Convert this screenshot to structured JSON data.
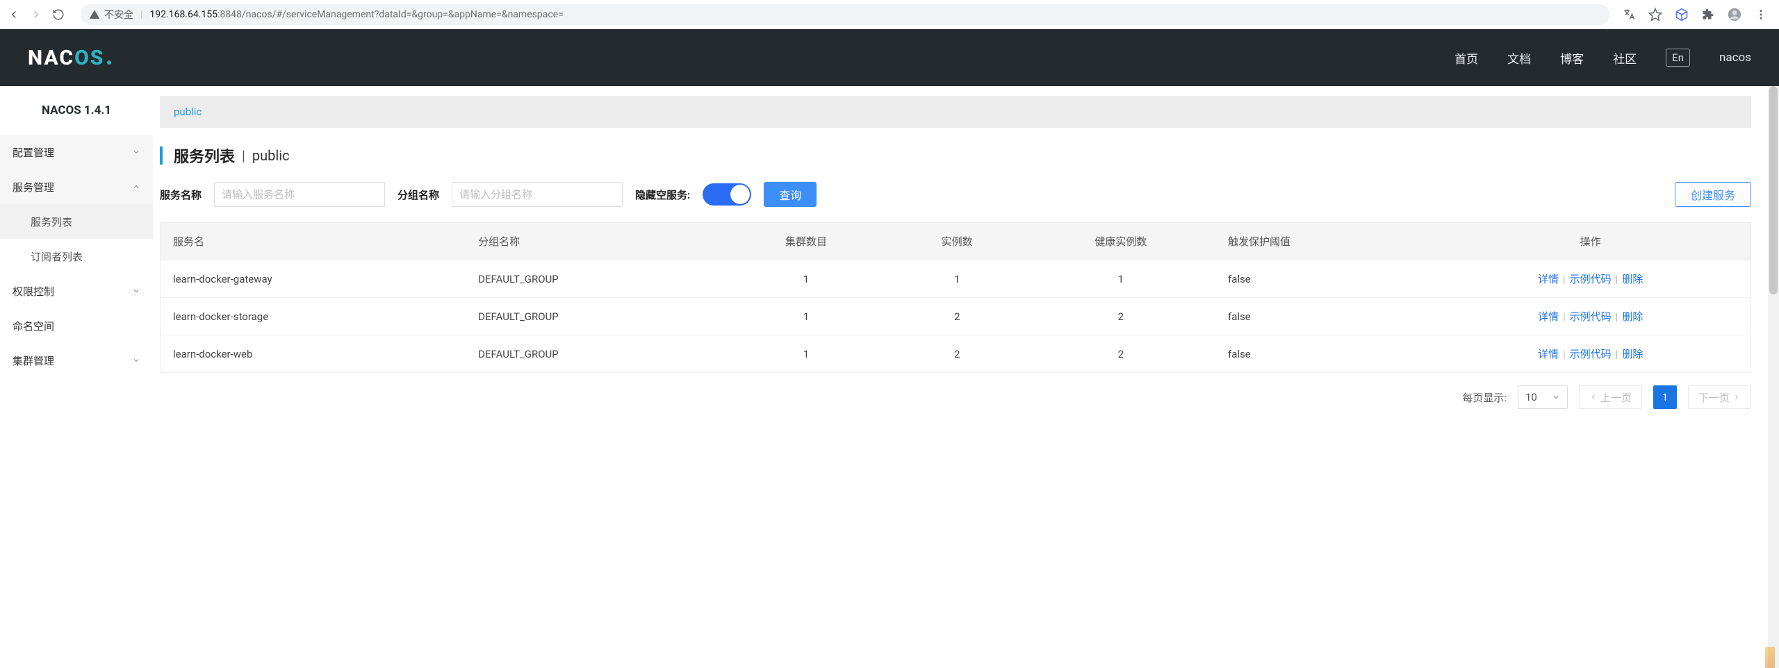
{
  "browser": {
    "insecure_label": "不安全",
    "url_host": "192.168.64.155",
    "url_port": ":8848",
    "url_path": "/nacos/#/serviceManagement?dataId=&group=&appName=&namespace="
  },
  "header": {
    "logo_plain": "NAC",
    "logo_accent": "OS",
    "nav": {
      "home": "首页",
      "docs": "文档",
      "blog": "博客",
      "community": "社区"
    },
    "lang": "En",
    "user": "nacos"
  },
  "sidebar": {
    "title": "NACOS 1.4.1",
    "config_mgr": "配置管理",
    "service_mgr": "服务管理",
    "service_list": "服务列表",
    "subscriber_list": "订阅者列表",
    "perm_ctrl": "权限控制",
    "namespace": "命名空间",
    "cluster_mgr": "集群管理"
  },
  "tabs": {
    "active": "public"
  },
  "page": {
    "title": "服务列表",
    "namespace": "public",
    "name_label": "服务名称",
    "name_placeholder": "请输入服务名称",
    "group_label": "分组名称",
    "group_placeholder": "请输入分组名称",
    "hide_empty_label": "隐藏空服务:",
    "query_btn": "查询",
    "create_btn": "创建服务"
  },
  "table": {
    "headers": {
      "name": "服务名",
      "group": "分组名称",
      "clusters": "集群数目",
      "instances": "实例数",
      "healthy": "健康实例数",
      "threshold": "触发保护阈值",
      "ops": "操作"
    },
    "ops": {
      "detail": "详情",
      "sample": "示例代码",
      "delete": "删除"
    },
    "rows": [
      {
        "name": "learn-docker-gateway",
        "group": "DEFAULT_GROUP",
        "clusters": "1",
        "instances": "1",
        "healthy": "1",
        "threshold": "false"
      },
      {
        "name": "learn-docker-storage",
        "group": "DEFAULT_GROUP",
        "clusters": "1",
        "instances": "2",
        "healthy": "2",
        "threshold": "false"
      },
      {
        "name": "learn-docker-web",
        "group": "DEFAULT_GROUP",
        "clusters": "1",
        "instances": "2",
        "healthy": "2",
        "threshold": "false"
      }
    ]
  },
  "pager": {
    "page_size_label": "每页显示:",
    "page_size_value": "10",
    "prev": "上一页",
    "next": "下一页",
    "current": "1"
  }
}
